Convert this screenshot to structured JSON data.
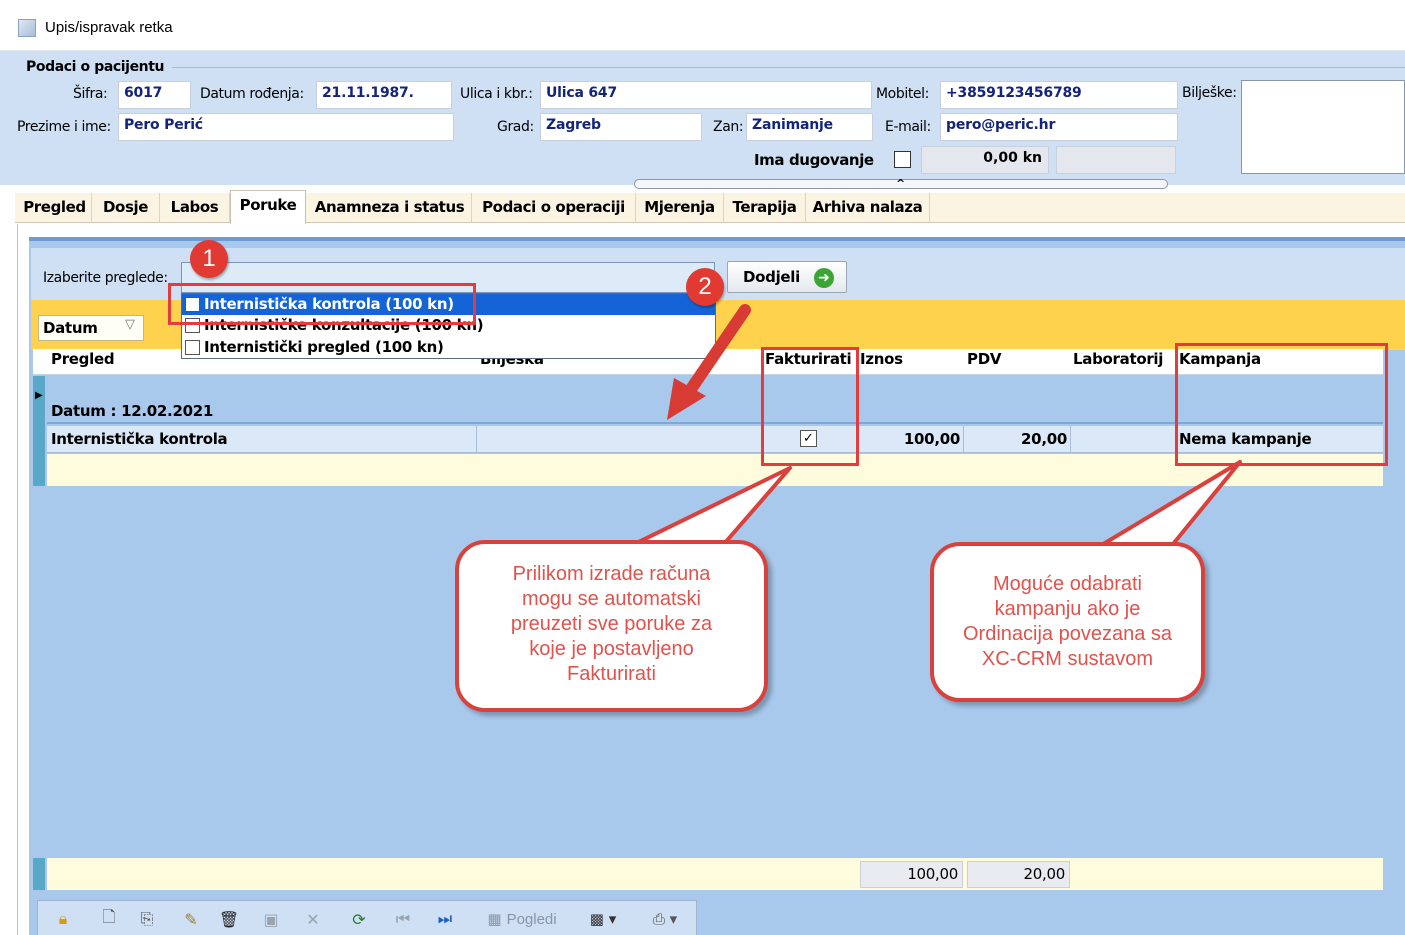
{
  "window": {
    "title": "Upis/ispravak retka"
  },
  "patient": {
    "section_title": "Podaci o pacijentu",
    "sifra_label": "Šifra:",
    "sifra": "6017",
    "dob_label": "Datum rođenja:",
    "dob": "21.11.1987.",
    "ulica_label": "Ulica i kbr.:",
    "ulica": "Ulica 647",
    "mobitel_label": "Mobitel:",
    "mobitel": "+3859123456789",
    "biljeske_label": "Bilješke:",
    "ime_label": "Prezime i ime:",
    "ime": "Pero Perić",
    "grad_label": "Grad:",
    "grad": "Zagreb",
    "zan_label": "Zan:",
    "zan": "Zanimanje",
    "email_label": "E-mail:",
    "email": "pero@peric.hr",
    "dug_label": "Ima dugovanje",
    "dug_amount": "0,00 kn"
  },
  "tabs": [
    "Pregled",
    "Dosje",
    "Labos",
    "Poruke",
    "Anamneza i status",
    "Podaci o operaciji",
    "Mjerenja",
    "Terapija",
    "Arhiva nalaza"
  ],
  "active_tab": "Poruke",
  "selector": {
    "label": "Izaberite preglede:",
    "assign_button": "Dodjeli",
    "options": [
      "Internistička kontrola (100 kn)",
      "Internističke konzultacije (100 kn)",
      "Internistički pregled (100 kn)"
    ]
  },
  "group_box": {
    "field": "Datum"
  },
  "table": {
    "headers": [
      "Pregled",
      "Bilješka",
      "Fakturirati",
      "Iznos",
      "PDV",
      "Laboratorij",
      "Kampanja"
    ],
    "group_label": "Datum : 12.02.2021",
    "row": {
      "pregled": "Internistička kontrola",
      "biljeska": "",
      "fakturirati": true,
      "iznos": "100,00",
      "pdv": "20,00",
      "laboratorij": "",
      "kampanja": "Nema kampanje"
    },
    "totals": {
      "iznos": "100,00",
      "pdv": "20,00"
    }
  },
  "toolbar": {
    "pogledi": "Pogledi"
  },
  "annotations": {
    "badge1": "1",
    "badge2": "2",
    "callout_left": "Prilikom izrade računa mogu se automatski preuzeti sve poruke za koje je postavljeno Fakturirati",
    "callout_right": "Moguće odabrati kampanju ako je Ordinacija povezana sa XC-CRM sustavom"
  },
  "colors": {
    "panel_blue": "#cfe0f5",
    "grid_blue": "#a8c8ec",
    "accent_yellow": "#ffd24d",
    "total_yellow": "#fffbdd",
    "annotation_red": "#e23c3c",
    "selection": "#1464d8"
  }
}
